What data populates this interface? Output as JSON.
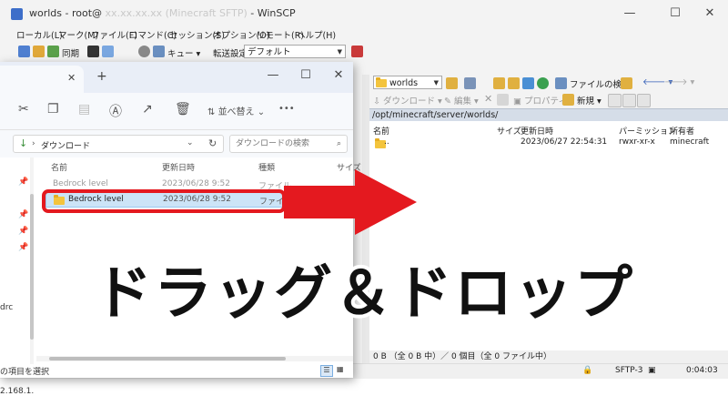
{
  "winscp": {
    "title": "worlds - root@",
    "app_name": "- WinSCP",
    "menu": [
      "ローカル(L)",
      "マーク(M)",
      "ファイル(F)",
      "コマンド(C)",
      "セッション(S)",
      "オプション(O)",
      "リモート(R)",
      "ヘルプ(H)"
    ],
    "toolbar": {
      "sync_label": "同期",
      "queue_label": "キュー",
      "transfer_settings_label": "転送設定",
      "transfer_preset": "デフォルト"
    },
    "remote": {
      "folder": "worlds",
      "find_files_label": "ファイルの検索",
      "download_label": "ダウンロード",
      "edit_label": "編集",
      "properties_label": "プロパティ",
      "new_label": "新規",
      "path": "/opt/minecraft/server/worlds/",
      "columns": [
        "名前",
        "サイズ",
        "更新日時",
        "パーミッション",
        "所有者"
      ],
      "rows": [
        {
          "name": "..",
          "size": "",
          "modified": "2023/06/27 22:54:31",
          "permissions": "rwxr-xr-x",
          "owner": "minecraft"
        }
      ],
      "status": "0 B （全 0 B 中）／ 0 個目（全 0 ファイル中）"
    },
    "bottom": {
      "protocol": "SFTP-3",
      "time": "0:04:03"
    }
  },
  "explorer": {
    "new_tab": "+",
    "sort_label": "並べ替え",
    "more_label": "•••",
    "address": "ダウンロード",
    "search_placeholder": "ダウンロードの検索",
    "columns": [
      "名前",
      "更新日時",
      "種類",
      "サイズ"
    ],
    "ghost_row": {
      "name": "Bedrock level",
      "modified": "2023/06/28 9:52",
      "type": "ファイル"
    },
    "rows": [
      {
        "name": "Bedrock level",
        "modified": "2023/06/28 9:52",
        "type": "ファイル"
      }
    ],
    "nav_items": [
      "drc",
      ")",
      "2.168.1.",
      "の項目を選択"
    ]
  },
  "caption": "ドラッグ＆ドロップ",
  "colors": {
    "highlight": "#e4191f",
    "arrow": "#e4191f",
    "selection": "#cce4f7"
  }
}
